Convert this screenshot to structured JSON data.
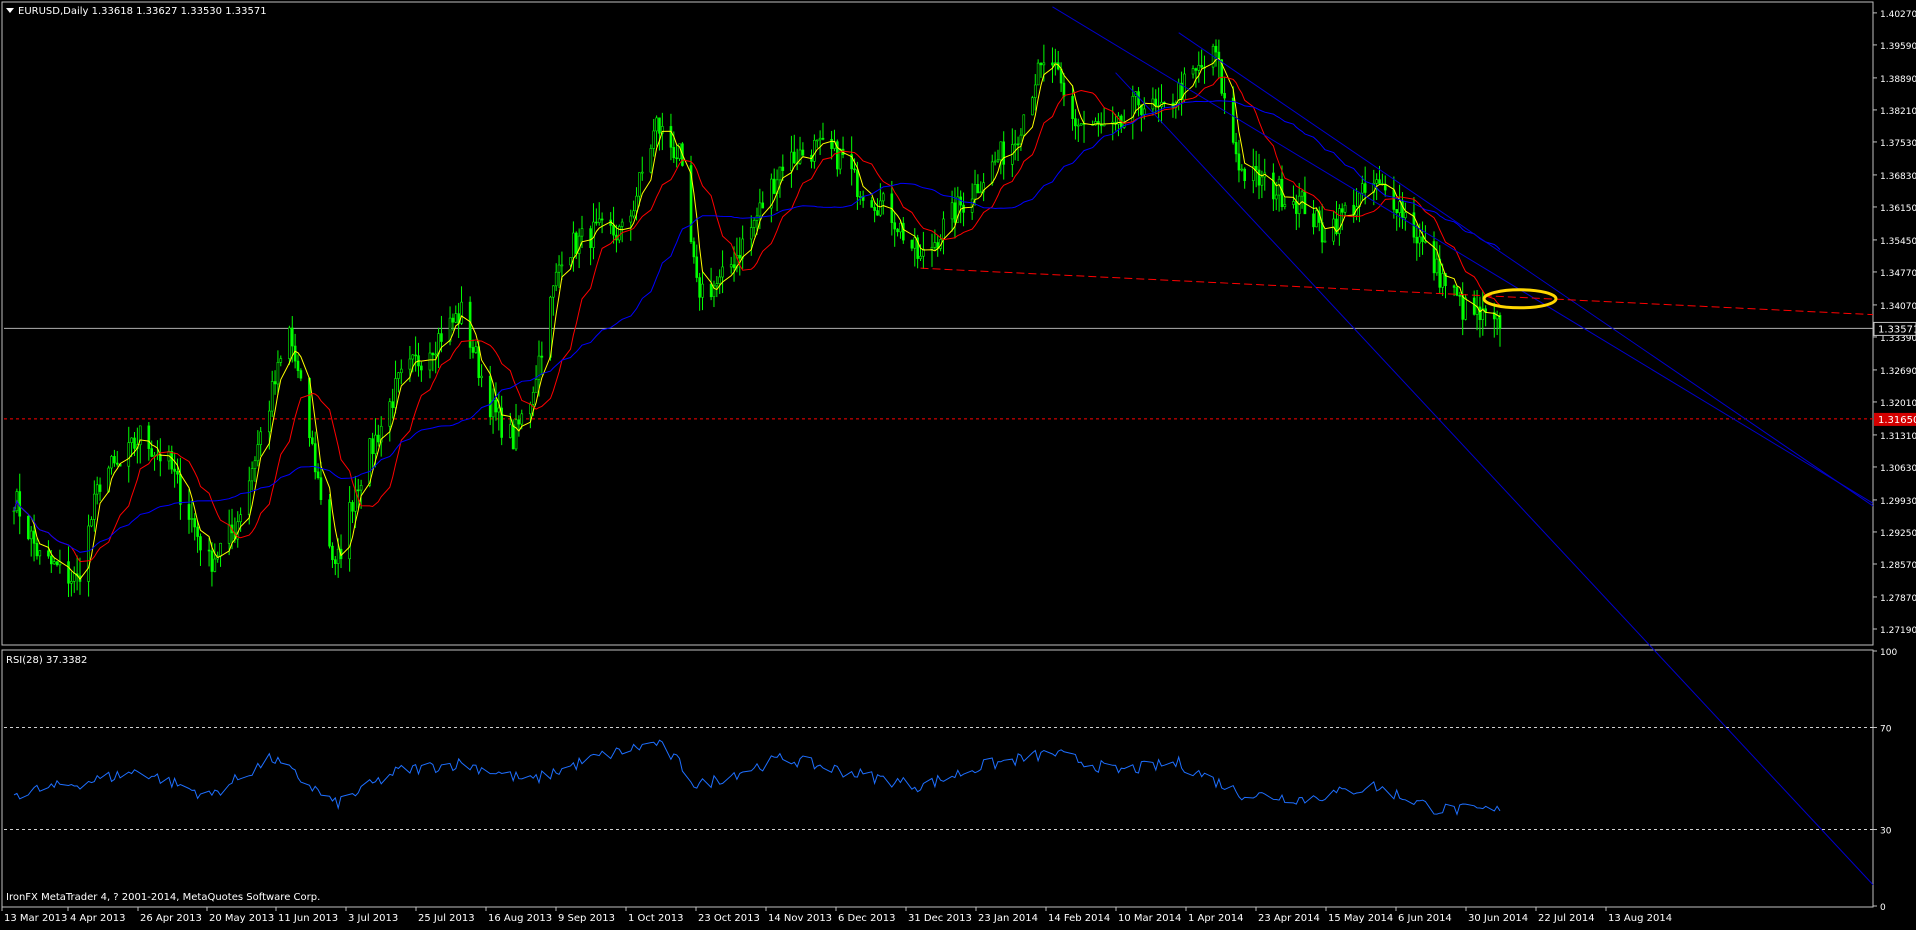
{
  "header": {
    "symbol_title": "EURUSD,Daily  1.33618 1.33627 1.33530 1.33571"
  },
  "rsi_panel": {
    "label": "RSI(28) 37.3382",
    "footer": "IronFX MetaTrader 4, ? 2001-2014, MetaQuotes Software Corp."
  },
  "colors": {
    "background": "#000000",
    "frame": "#c0c0c0",
    "candle": "#00ff00",
    "ma_fast": "#ffff00",
    "ma_mid": "#ff0000",
    "ma_slow": "#0000ff",
    "channel": "#0000cd",
    "rsi_line": "#1e6fff",
    "support_line": "#ff0000",
    "marker": "#ffd700",
    "axis_text": "#ffffff"
  },
  "chart_data": [
    {
      "type": "candlestick",
      "title": "EURUSD,Daily",
      "ohlc_readout": {
        "open": 1.33618,
        "high": 1.33627,
        "low": 1.3353,
        "close": 1.33571
      },
      "ylim": [
        1.2685,
        1.4048
      ],
      "y_ticks": [
        "1.40270",
        "1.39590",
        "1.38890",
        "1.38210",
        "1.37530",
        "1.36830",
        "1.36150",
        "1.35450",
        "1.34770",
        "1.34070",
        "1.33390",
        "1.32690",
        "1.32010",
        "1.31310",
        "1.30630",
        "1.29930",
        "1.29250",
        "1.28570",
        "1.27870",
        "1.27190"
      ],
      "x_tick_labels": [
        "13 Mar 2013",
        "4 Apr 2013",
        "26 Apr 2013",
        "20 May 2013",
        "11 Jun 2013",
        "3 Jul 2013",
        "25 Jul 2013",
        "16 Aug 2013",
        "9 Sep 2013",
        "1 Oct 2013",
        "23 Oct 2013",
        "14 Nov 2013",
        "6 Dec 2013",
        "31 Dec 2013",
        "23 Jan 2014",
        "14 Feb 2014",
        "10 Mar 2014",
        "1 Apr 2014",
        "23 Apr 2014",
        "15 May 2014",
        "6 Jun 2014",
        "30 Jun 2014",
        "22 Jul 2014",
        "13 Aug 2014"
      ],
      "current_price_label": "1.33571",
      "current_price": 1.33571,
      "red_level_label": "1.31650",
      "red_level": 1.3165,
      "close_path": [
        [
          "13 Mar 2013",
          1.3
        ],
        [
          "22 Mar 2013",
          1.287
        ],
        [
          "4 Apr 2013",
          1.282
        ],
        [
          "13 Apr 2013",
          1.306
        ],
        [
          "19 Apr 2013",
          1.306
        ],
        [
          "26 Apr 2013",
          1.313
        ],
        [
          "6 May 2013",
          1.307
        ],
        [
          "20 May 2013",
          1.286
        ],
        [
          "29 May 2013",
          1.293
        ],
        [
          "11 Jun 2013",
          1.322
        ],
        [
          "17 Jun 2013",
          1.335
        ],
        [
          "25 Jun 2013",
          1.31
        ],
        [
          "3 Jul 2013",
          1.284
        ],
        [
          "10 Jul 2013",
          1.302
        ],
        [
          "25 Jul 2013",
          1.324
        ],
        [
          "5 Aug 2013",
          1.332
        ],
        [
          "16 Aug 2013",
          1.339
        ],
        [
          "27 Aug 2013",
          1.318
        ],
        [
          "3 Sep 2013",
          1.312
        ],
        [
          "9 Sep 2013",
          1.321
        ],
        [
          "20 Sep 2013",
          1.352
        ],
        [
          "1 Oct 2013",
          1.356
        ],
        [
          "12 Oct 2013",
          1.356
        ],
        [
          "23 Oct 2013",
          1.379
        ],
        [
          "31 Oct 2013",
          1.372
        ],
        [
          "6 Nov 2013",
          1.344
        ],
        [
          "14 Nov 2013",
          1.345
        ],
        [
          "25 Nov 2013",
          1.357
        ],
        [
          "6 Dec 2013",
          1.371
        ],
        [
          "17 Dec 2013",
          1.374
        ],
        [
          "27 Dec 2013",
          1.372
        ],
        [
          "31 Dec 2013",
          1.367
        ],
        [
          "13 Jan 2014",
          1.36
        ],
        [
          "23 Jan 2014",
          1.35
        ],
        [
          "1 Feb 2014",
          1.358
        ],
        [
          "14 Feb 2014",
          1.368
        ],
        [
          "25 Feb 2014",
          1.376
        ],
        [
          "4 Mar 2014",
          1.389
        ],
        [
          "10 Mar 2014",
          1.392
        ],
        [
          "16 Mar 2014",
          1.38
        ],
        [
          "1 Apr 2014",
          1.377
        ],
        [
          "9 Apr 2014",
          1.384
        ],
        [
          "17 Apr 2014",
          1.381
        ],
        [
          "23 Apr 2014",
          1.386
        ],
        [
          "6 May 2014",
          1.394
        ],
        [
          "10 May 2014",
          1.38
        ],
        [
          "15 May 2014",
          1.369
        ],
        [
          "6 Jun 2014",
          1.362
        ],
        [
          "12 Jun 2014",
          1.356
        ],
        [
          "23 Jun 2014",
          1.362
        ],
        [
          "30 Jun 2014",
          1.366
        ],
        [
          "8 Jul 2014",
          1.363
        ],
        [
          "22 Jul 2014",
          1.348
        ],
        [
          "31 Jul 2014",
          1.34
        ],
        [
          "13 Aug 2014",
          1.3357
        ]
      ],
      "series": [
        {
          "name": "MA fast",
          "color": "#ffff00"
        },
        {
          "name": "MA mid",
          "color": "#ff0000"
        },
        {
          "name": "MA slow",
          "color": "#0000ff"
        }
      ],
      "support_trendline": {
        "from": [
          "23 Jan 2014",
          1.3485
        ],
        "to": [
          "13 Aug 2014",
          1.3425
        ],
        "style": "dashed",
        "color": "#ff0000"
      },
      "channel_lines": [
        {
          "from": [
            "10 Mar 2014",
            1.404
          ],
          "to": [
            "13 Aug 2014",
            1.3465
          ]
        },
        {
          "from": [
            "1 Apr 2014",
            1.39
          ],
          "to": [
            "13 Aug 2014",
            1.3025
          ]
        },
        {
          "from": [
            "23 Apr 2014",
            1.3985
          ],
          "to": [
            "13 Aug 2014",
            1.352
          ]
        }
      ],
      "highlight_ellipse": {
        "at": [
          "13 Aug 2014",
          1.342
        ],
        "color": "#ffd700"
      }
    },
    {
      "type": "line",
      "title": "RSI(28) 37.3382",
      "ylim": [
        0,
        100
      ],
      "y_ticks": [
        "100",
        "70",
        "30",
        "0"
      ],
      "levels": [
        70,
        30
      ],
      "last_value": 37.3382,
      "rsi_path": [
        [
          "13 Mar 2013",
          44
        ],
        [
          "4 Apr 2013",
          48
        ],
        [
          "26 Apr 2013",
          53
        ],
        [
          "20 May 2013",
          43
        ],
        [
          "11 Jun 2013",
          58
        ],
        [
          "3 Jul 2013",
          40
        ],
        [
          "25 Jul 2013",
          53
        ],
        [
          "16 Aug 2013",
          56
        ],
        [
          "9 Sep 2013",
          49
        ],
        [
          "1 Oct 2013",
          58
        ],
        [
          "23 Oct 2013",
          64
        ],
        [
          "31 Oct 2013",
          56
        ],
        [
          "6 Nov 2013",
          47
        ],
        [
          "14 Nov 2013",
          50
        ],
        [
          "6 Dec 2013",
          58
        ],
        [
          "31 Dec 2013",
          52
        ],
        [
          "23 Jan 2014",
          47
        ],
        [
          "14 Feb 2014",
          55
        ],
        [
          "10 Mar 2014",
          60
        ],
        [
          "1 Apr 2014",
          53
        ],
        [
          "23 Apr 2014",
          56
        ],
        [
          "15 May 2014",
          44
        ],
        [
          "6 Jun 2014",
          42
        ],
        [
          "30 Jun 2014",
          47
        ],
        [
          "22 Jul 2014",
          38
        ],
        [
          "13 Aug 2014",
          37.3
        ]
      ]
    }
  ]
}
